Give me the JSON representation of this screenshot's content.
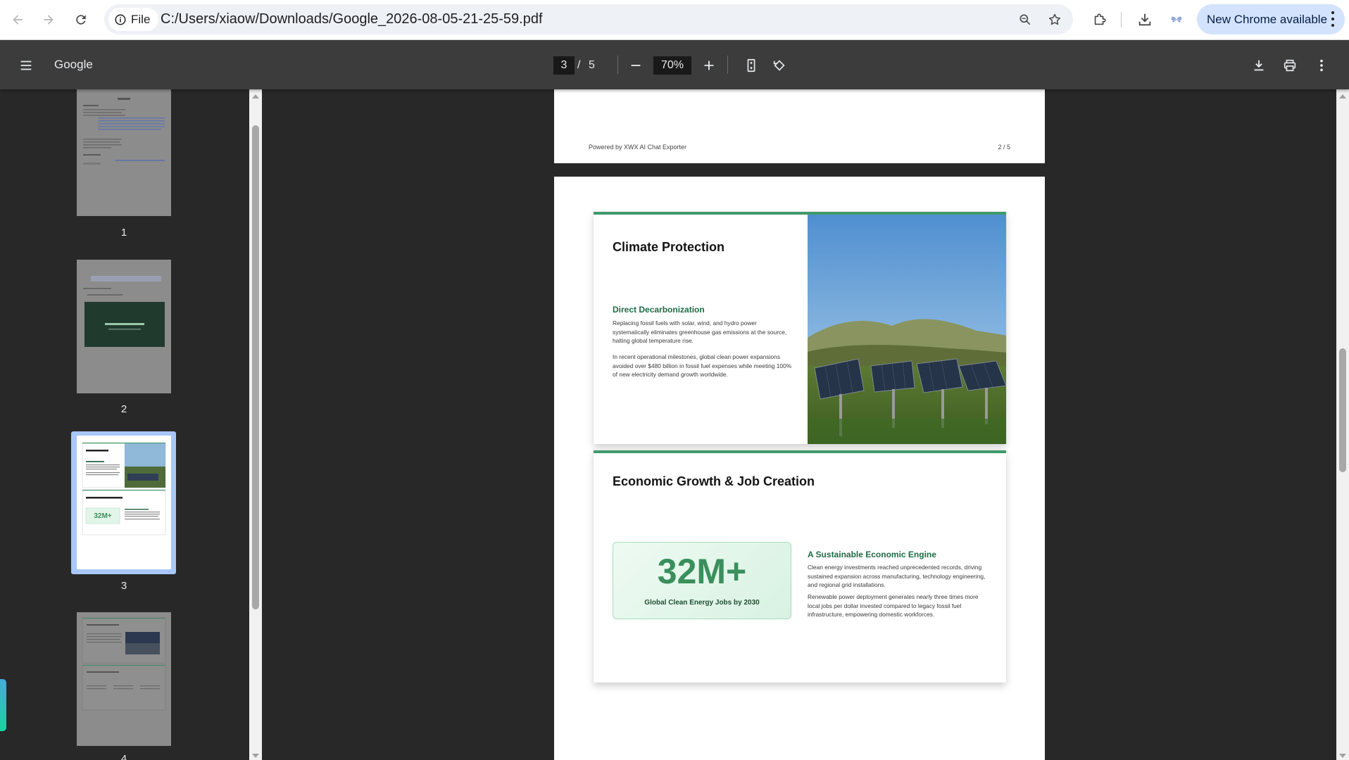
{
  "browser": {
    "url_scheme_label": "File",
    "url": "C:/Users/xiaow/Downloads/Google_2026-08-05-21-25-59.pdf",
    "update_button_label": "New Chrome available"
  },
  "pdf_toolbar": {
    "doc_title": "Google",
    "current_page": "3",
    "page_separator": "/",
    "total_pages": "5",
    "zoom": "70%"
  },
  "sidebar": {
    "thumbnails": [
      {
        "number": "1",
        "selected": false
      },
      {
        "number": "2",
        "selected": false
      },
      {
        "number": "3",
        "selected": true
      },
      {
        "number": "4",
        "selected": false
      }
    ]
  },
  "previous_page": {
    "footer_left": "Powered by XWX AI Chat Exporter",
    "footer_right": "2 / 5"
  },
  "current_page": {
    "card1": {
      "title": "Climate Protection",
      "subtitle": "Direct Decarbonization",
      "para1": "Replacing fossil fuels with solar, wind, and hydro power systematically eliminates greenhouse gas emissions at the source, halting global temperature rise.",
      "para2": "In recent operational milestones, global clean power expansions avoided over $480 billion in fossil fuel expenses while meeting 100% of new electricity demand growth worldwide."
    },
    "card2": {
      "title": "Economic Growth & Job Creation",
      "stat_value": "32M+",
      "stat_label": "Global Clean Energy Jobs by 2030",
      "subtitle": "A Sustainable Economic Engine",
      "para1": "Clean energy investments reached unprecedented records, driving sustained expansion across manufacturing, technology engineering, and regional grid installations.",
      "para2": "Renewable power deployment generates nearly three times more local jobs per dollar invested compared to legacy fossil fuel infrastructure, empowering domestic workforces."
    }
  },
  "colors": {
    "accent_green": "#3f9a6a",
    "selection_blue": "#a8c7fa",
    "toolbar_bg": "#3c3c3c"
  }
}
